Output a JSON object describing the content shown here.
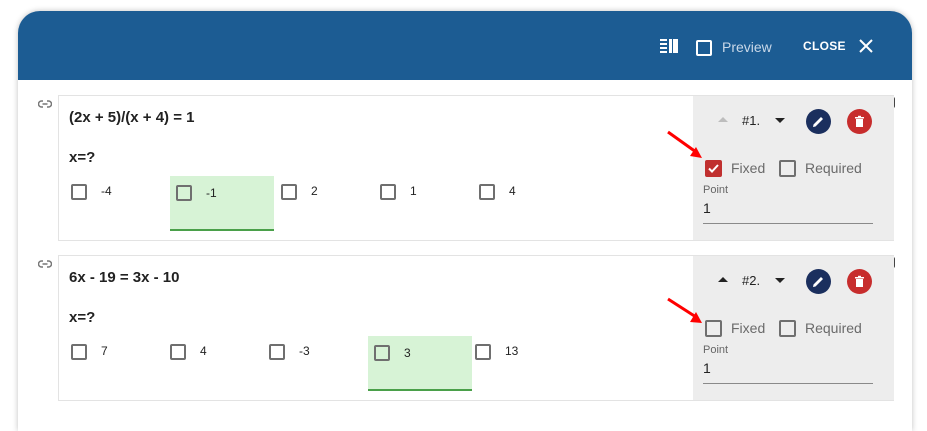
{
  "header": {
    "preview_label": "Preview",
    "close_label": "CLOSE",
    "background": "#1c5c93"
  },
  "questions": [
    {
      "title": "(2x + 5)/(x + 4) = 1",
      "subtitle": "x=?",
      "options": [
        "-4",
        "-1",
        "2",
        "1",
        "4"
      ],
      "correct_option": "-1",
      "number": "#1.",
      "fixed_label": "Fixed",
      "fixed_checked": true,
      "required_label": "Required",
      "required_checked": false,
      "point_label": "Point",
      "point_value": "1"
    },
    {
      "title": "6x - 19 = 3x - 10",
      "subtitle": "x=?",
      "options": [
        "7",
        "4",
        "-3",
        "3",
        "13"
      ],
      "correct_option": "3",
      "number": "#2.",
      "fixed_label": "Fixed",
      "fixed_checked": false,
      "required_label": "Required",
      "required_checked": false,
      "point_label": "Point",
      "point_value": "1"
    }
  ],
  "colors": {
    "edit_button": "#1b2f5e",
    "delete_button": "#c72d2d",
    "fixed_checked": "#c0302f",
    "correct_option_bg": "#d7f3d6",
    "annotation_arrow": "#ff0000"
  },
  "icons": [
    "layout-columns-icon",
    "close-icon",
    "link-icon",
    "arrow-up-icon",
    "arrow-down-icon",
    "pencil-icon",
    "trash-icon",
    "red-annotation-arrow"
  ]
}
